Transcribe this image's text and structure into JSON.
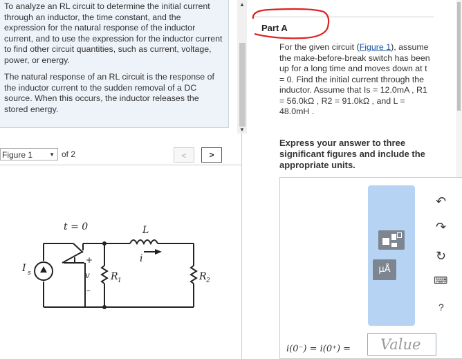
{
  "intro": {
    "p1": "To analyze an RL circuit to determine the initial current through an inductor, the time constant, and the expression for the natural response of the inductor current, and to use the expression for the inductor current to find other circuit quantities, such as current, voltage, power, or energy.",
    "p2": "The natural response of an RL circuit is the response of the inductor current to the sudden removal of a DC source. When this occurs, the inductor releases the stored energy."
  },
  "figure_nav": {
    "selected": "Figure 1",
    "of_label": "of 2",
    "prev_label": "<",
    "next_label": ">"
  },
  "circuit": {
    "switch_label": "t = 0",
    "inductor_label": "L",
    "current_label": "i",
    "source_label": "I",
    "source_sub": "s",
    "voltage_label": "v",
    "plus": "+",
    "minus": "–",
    "r1_label": "R",
    "r1_sub": "1",
    "r2_label": "R",
    "r2_sub": "2"
  },
  "partA": {
    "title": "Part A",
    "q_intro": "For the given circuit (",
    "figure_link": "Figure 1",
    "q_text": "), assume the make-before-break switch has been up for a long time and moves down at t = 0. Find the initial current through the inductor. Assume that Is = 12.0mA , R1 = 56.0kΩ , R2 = 91.0kΩ , and L = 48.0mH .",
    "instructions": "Express your answer to three significant figures and include the appropriate units."
  },
  "answer": {
    "units_button": "μÅ",
    "equation": "i(0⁻) = i(0⁺) =",
    "value_placeholder": "Value"
  },
  "colors": {
    "toolbar": "#b7d3f3",
    "link": "#1a57a5",
    "annotation": "#e0201f",
    "intro_bg": "#eef3f9"
  },
  "icons": [
    "undo-icon",
    "redo-icon",
    "reset-icon",
    "keyboard-icon",
    "help-icon",
    "templates-icon",
    "units-icon"
  ]
}
